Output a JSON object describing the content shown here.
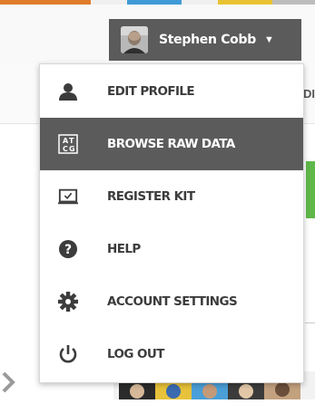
{
  "brand": {
    "strip_colors": [
      "#e07b2a",
      "#ffffff",
      "#3f9ad6",
      "#ffffff",
      "#e9c233",
      "#ffffff",
      "#9a9a9a"
    ]
  },
  "header": {
    "user_name": "Stephen Cobb",
    "caret_icon": "caret-down-icon",
    "button_color": "#5b5b5b"
  },
  "background": {
    "partial_text": "DI"
  },
  "menu": {
    "items": [
      {
        "label": "EDIT PROFILE",
        "icon": "user-icon",
        "active": false
      },
      {
        "label": "BROWSE RAW DATA",
        "icon": "atcg-icon",
        "active": true
      },
      {
        "label": "REGISTER KIT",
        "icon": "kit-screen-icon",
        "active": false
      },
      {
        "label": "HELP",
        "icon": "help-icon",
        "active": false
      },
      {
        "label": "ACCOUNT SETTINGS",
        "icon": "gear-icon",
        "active": false
      },
      {
        "label": "LOG OUT",
        "icon": "power-icon",
        "active": false
      }
    ],
    "active_color": "#5b5b5b",
    "icon_glyph_letters": [
      "A",
      "T",
      "C",
      "G"
    ]
  }
}
